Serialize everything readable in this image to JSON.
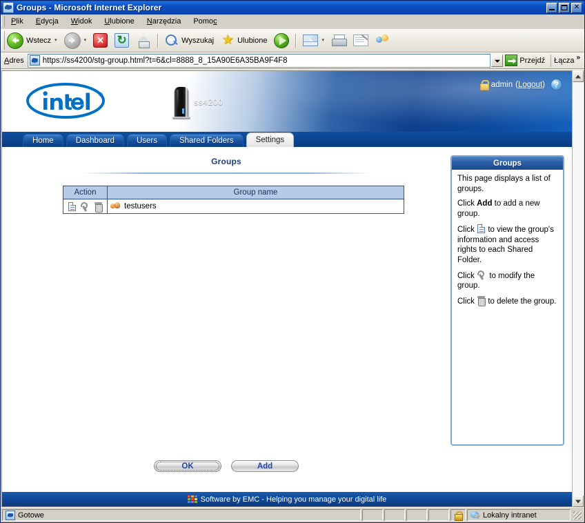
{
  "window": {
    "title": "Groups - Microsoft Internet Explorer",
    "icon": "ie-document-icon",
    "minimize_label": "Minimize",
    "maximize_label": "Maximize",
    "close_label": "✕"
  },
  "menu": {
    "items": [
      {
        "label": "Plik",
        "accel": "P",
        "accel_index": 0
      },
      {
        "label": "Edycja",
        "accel": "E",
        "accel_index": 0
      },
      {
        "label": "Widok",
        "accel": "W",
        "accel_index": 0
      },
      {
        "label": "Ulubione",
        "accel": "U",
        "accel_index": 0
      },
      {
        "label": "Narzędzia",
        "accel": "N",
        "accel_index": 0
      },
      {
        "label": "Pomoc",
        "accel": "c",
        "accel_index": 4
      }
    ]
  },
  "toolbar": {
    "back_label": "Wstecz",
    "forward_label": "",
    "stop_label": "",
    "refresh_label": "",
    "home_label": "",
    "search_label": "Wyszukaj",
    "favorites_label": "Ulubione",
    "media_label": "",
    "mail_label": "",
    "print_label": "",
    "edit_label": "",
    "messenger_label": "",
    "dropdown_glyph": "▾"
  },
  "address_bar": {
    "label": "Adres",
    "label_accel": "A",
    "url": "https://ss4200/stg-group.html?t=6&cl=8888_8_15A90E6A35BA9F4F8",
    "go_label": "Przejdź",
    "links_label": "Łącza",
    "links_chevron": "»"
  },
  "site_header": {
    "brand": "intel",
    "brand_trademark": "®",
    "device_name": "ss4200",
    "user_name": "admin",
    "logout_label": "Logout",
    "user_paren_open": "(",
    "user_paren_close": ")",
    "help_glyph": "?"
  },
  "nav_tabs": [
    {
      "label": "Home",
      "active": false
    },
    {
      "label": "Dashboard",
      "active": false
    },
    {
      "label": "Users",
      "active": false
    },
    {
      "label": "Shared Folders",
      "active": false
    },
    {
      "label": "Settings",
      "active": true
    }
  ],
  "main": {
    "page_title": "Groups",
    "table": {
      "columns": [
        "Action",
        "Group name"
      ],
      "rows": [
        {
          "actions": [
            "view-icon",
            "modify-icon",
            "delete-icon"
          ],
          "group_icon": "group-icon",
          "group_name": "testusers"
        }
      ]
    },
    "buttons": [
      {
        "label": "OK",
        "focused": true
      },
      {
        "label": "Add",
        "focused": false
      }
    ]
  },
  "help_panel": {
    "title": "Groups",
    "paragraphs": [
      {
        "parts": [
          {
            "t": "This page displays a list of groups."
          }
        ]
      },
      {
        "parts": [
          {
            "t": "Click "
          },
          {
            "t": "Add",
            "bold": true
          },
          {
            "t": " to add a new group."
          }
        ]
      },
      {
        "parts": [
          {
            "t": "Click "
          },
          {
            "icon": "doc"
          },
          {
            "t": " to view the group's information and access rights to each Shared Folder."
          }
        ]
      },
      {
        "parts": [
          {
            "t": "Click "
          },
          {
            "icon": "wrench"
          },
          {
            "t": " to modify the group."
          }
        ]
      },
      {
        "parts": [
          {
            "t": "Click "
          },
          {
            "icon": "trash"
          },
          {
            "t": " to delete the group."
          }
        ]
      }
    ]
  },
  "site_footer": {
    "text": "Software by EMC - Helping you manage your digital life",
    "logo_colors": [
      "#d94f3d",
      "#f0a63c",
      "#4f86d4",
      "#7fb34a",
      "#d94f3d",
      "#f0d24f",
      "#4f86d4",
      "#9a6fbf",
      "#7fb34a"
    ]
  },
  "status_bar": {
    "status": "Gotowe",
    "zone": "Lokalny intranet",
    "secure_icon": "lock-icon"
  },
  "scrollbar": {
    "up_glyph": "▲",
    "down_glyph": "▼"
  },
  "colors": {
    "titlebar_blue": "#0a4ec0",
    "header_blue": "#0d3f8e",
    "tab_active_bg": "#ededed",
    "table_header_bg": "#b6cbe8",
    "table_border": "#2a5394",
    "help_border": "#7da7d9",
    "button_text": "#1d46a0",
    "title_text": "#1d3f7a"
  }
}
